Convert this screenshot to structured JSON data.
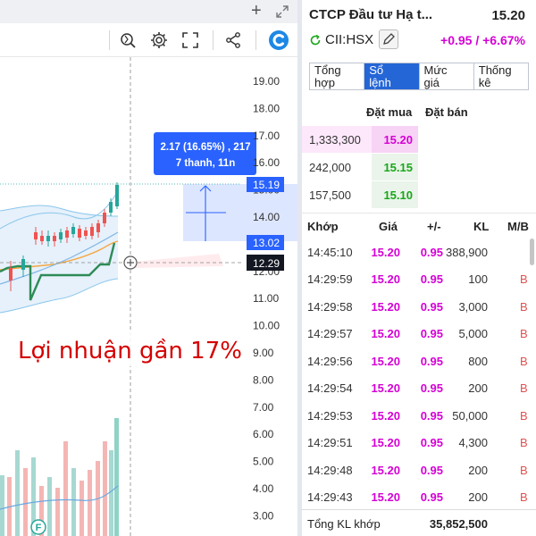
{
  "chart": {
    "annotation_text": "Lợi nhuận gần 17%",
    "tooltip_line1": "2.17 (16.65%) , 217",
    "tooltip_line2": "7 thanh, 11n",
    "price_axis": [
      "19.00",
      "18.00",
      "17.00",
      "16.00",
      "15.00",
      "14.00",
      "13.00",
      "12.00",
      "11.00",
      "10.00",
      "9.00",
      "8.00",
      "7.00",
      "6.00",
      "5.00",
      "4.00",
      "3.00"
    ],
    "tag_upper": "15.19",
    "tag_lower": "13.02",
    "tag_cursor": "12.29",
    "marker_label": "F",
    "colors": {
      "up": "#26a69a",
      "down": "#ef5350",
      "tooltip": "#2962ff",
      "annotation": "#d50000"
    }
  },
  "panel": {
    "stock_name": "CTCP Đầu tư Hạ t...",
    "price": "15.20",
    "ticker": "CII:HSX",
    "change": "+0.95 / +6.67%",
    "tabs": [
      {
        "l1": "Tổng",
        "l2": "hợp"
      },
      {
        "l1": "Sổ",
        "l2": "lệnh"
      },
      {
        "l1": "Mức",
        "l2": "giá"
      },
      {
        "l1": "Thống",
        "l2": "kê"
      }
    ],
    "bid_header": "Đặt mua",
    "ask_header": "Đặt bán",
    "order_book": [
      {
        "volume": "1,333,300",
        "price": "15.20",
        "color": "#d500d5"
      },
      {
        "volume": "242,000",
        "price": "15.15",
        "color": "#1aa61a"
      },
      {
        "volume": "157,500",
        "price": "15.10",
        "color": "#1aa61a"
      }
    ],
    "match_headers": {
      "time": "Khớp",
      "price": "Giá",
      "change": "+/-",
      "volume": "KL",
      "side": "M/B"
    },
    "trades": [
      {
        "time": "14:45:10",
        "price": "15.20",
        "change": "0.95",
        "volume": "388,900",
        "side": ""
      },
      {
        "time": "14:29:59",
        "price": "15.20",
        "change": "0.95",
        "volume": "100",
        "side": "B"
      },
      {
        "time": "14:29:58",
        "price": "15.20",
        "change": "0.95",
        "volume": "3,000",
        "side": "B"
      },
      {
        "time": "14:29:57",
        "price": "15.20",
        "change": "0.95",
        "volume": "5,000",
        "side": "B"
      },
      {
        "time": "14:29:56",
        "price": "15.20",
        "change": "0.95",
        "volume": "800",
        "side": "B"
      },
      {
        "time": "14:29:54",
        "price": "15.20",
        "change": "0.95",
        "volume": "200",
        "side": "B"
      },
      {
        "time": "14:29:53",
        "price": "15.20",
        "change": "0.95",
        "volume": "50,000",
        "side": "B"
      },
      {
        "time": "14:29:51",
        "price": "15.20",
        "change": "0.95",
        "volume": "4,300",
        "side": "B"
      },
      {
        "time": "14:29:48",
        "price": "15.20",
        "change": "0.95",
        "volume": "200",
        "side": "B"
      },
      {
        "time": "14:29:43",
        "price": "15.20",
        "change": "0.95",
        "volume": "200",
        "side": "B"
      }
    ],
    "footer_label": "Tổng KL khớp",
    "footer_value": "35,852,500",
    "colors": {
      "accent": "#2566d6",
      "ceiling": "#d500d5",
      "up": "#1aa61a",
      "buy": "#e05252"
    }
  }
}
